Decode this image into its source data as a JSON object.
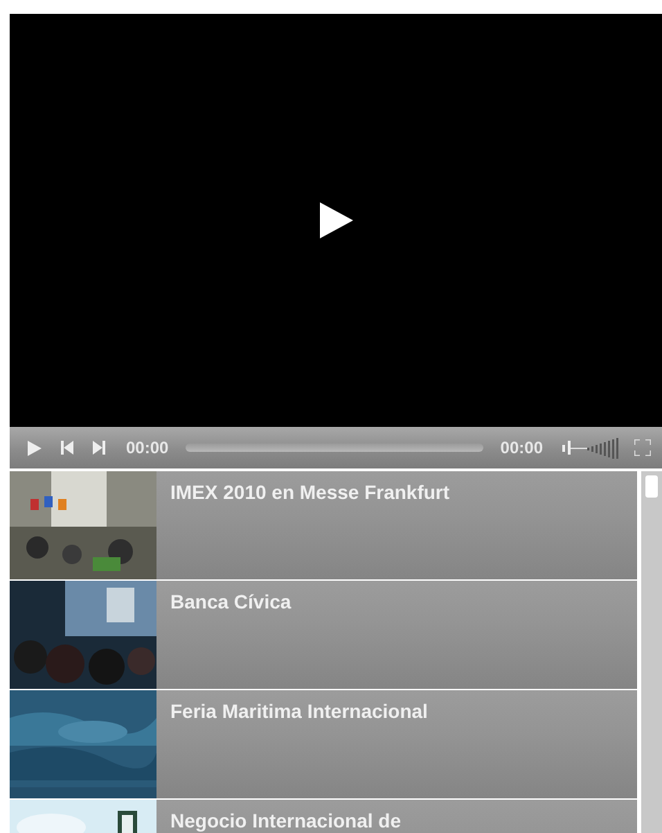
{
  "player": {
    "current_time": "00:00",
    "total_time": "00:00"
  },
  "playlist": [
    {
      "title": "IMEX 2010 en Messe Frankfurt"
    },
    {
      "title": "Banca Cívica"
    },
    {
      "title": "Feria Maritima Internacional"
    },
    {
      "title": "Negocio Internacional de"
    }
  ]
}
